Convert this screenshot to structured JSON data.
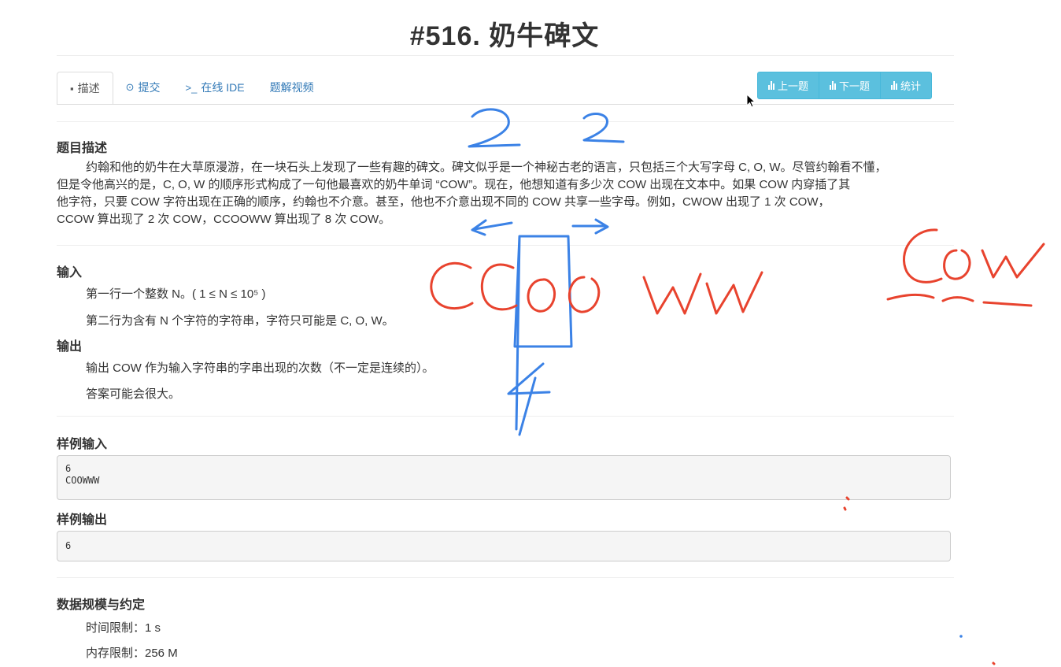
{
  "title": "#516. 奶牛碑文",
  "tabs": [
    {
      "icon": "book-icon",
      "label": "描述"
    },
    {
      "icon": "upload-icon",
      "label": "提交"
    },
    {
      "icon": "terminal-icon",
      "label": "在线 IDE"
    },
    {
      "icon": "",
      "label": "题解视频"
    }
  ],
  "nav_buttons": [
    "上一题",
    "下一题",
    "统计"
  ],
  "sections": {
    "desc_heading": "题目描述",
    "desc_line1": "约翰和他的奶牛在大草原漫游，在一块石头上发现了一些有趣的碑文。碑文似乎是一个神秘古老的语言，只包括三个大写字母 C, O, W。尽管约翰看不懂，",
    "desc_line2": "但是令他高兴的是，C, O, W 的顺序形式构成了一句他最喜欢的奶牛单词 “COW”。现在，他想知道有多少次 COW 出现在文本中。如果 COW 内穿插了其",
    "desc_line3": "他字符，只要 COW 字符出现在正确的顺序，约翰也不介意。甚至，他也不介意出现不同的 COW 共享一些字母。例如，CWOW 出现了 1 次 COW，",
    "desc_line4": "CCOW 算出现了 2 次 COW，CCOOWW 算出现了 8 次 COW。",
    "input_heading": "输入",
    "input_line1": "第一行一个整数 N。( 1 ≤ N ≤ 10⁵ )",
    "input_line2": "第二行为含有 N 个字符的字符串，字符只可能是 C, O, W。",
    "output_heading": "输出",
    "output_line1": "输出 COW 作为输入字符串的字串出现的次数（不一定是连续的）。",
    "output_line2": "答案可能会很大。",
    "sample_in_heading": "样例输入",
    "sample_in_line1": "6",
    "sample_in_line2": "COOWWW",
    "sample_out_heading": "样例输出",
    "sample_out": "6",
    "limits_heading": "数据规模与约定",
    "time_limit": "时间限制：1 s",
    "mem_limit": "内存限制：256 M"
  },
  "annotations": {
    "num_left": "2",
    "num_right": "2",
    "num_bottom": "4",
    "red_word": "CCOO WW",
    "red_word_right": "COW"
  },
  "colors": {
    "link": "#337ab7",
    "button": "#5bc0de",
    "ink_blue": "#3b82e6",
    "ink_red": "#e8432e"
  }
}
